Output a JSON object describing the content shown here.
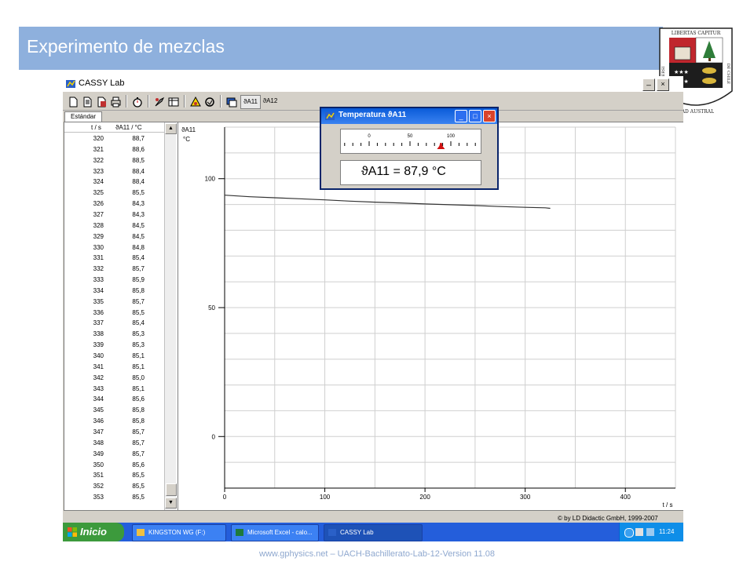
{
  "slide": {
    "title": "Experimento de mezclas",
    "footer": "www.gphysics.net – UACH-Bachillerato-Lab-12-Version 11.08",
    "crest": {
      "top_banner": "LIBERTAS CAPITUR",
      "left_banner": "UNIVERSI",
      "bottom_banner": "DAD AUSTRAL",
      "right_banner": "DE CHILE"
    }
  },
  "app": {
    "title": "CASSY Lab",
    "tab": "Estándar",
    "toolbar_icons": [
      "new-icon",
      "open-icon",
      "save-icon",
      "print-icon",
      "stopwatch-icon",
      "settings-icon",
      "table-icon",
      "measure-icon",
      "clear-icon",
      "window-icon"
    ],
    "sensor_buttons": [
      "ϑA11",
      "ϑA12"
    ],
    "table": {
      "headers": [
        "t / s",
        "ϑA11 / °C"
      ],
      "rows": [
        [
          "320",
          "88,7"
        ],
        [
          "321",
          "88,6"
        ],
        [
          "322",
          "88,5"
        ],
        [
          "323",
          "88,4"
        ],
        [
          "324",
          "88,4"
        ],
        [
          "325",
          "85,5"
        ],
        [
          "326",
          "84,3"
        ],
        [
          "327",
          "84,3"
        ],
        [
          "328",
          "84,5"
        ],
        [
          "329",
          "84,5"
        ],
        [
          "330",
          "84,8"
        ],
        [
          "331",
          "85,4"
        ],
        [
          "332",
          "85,7"
        ],
        [
          "333",
          "85,9"
        ],
        [
          "334",
          "85,8"
        ],
        [
          "335",
          "85,7"
        ],
        [
          "336",
          "85,5"
        ],
        [
          "337",
          "85,4"
        ],
        [
          "338",
          "85,3"
        ],
        [
          "339",
          "85,3"
        ],
        [
          "340",
          "85,1"
        ],
        [
          "341",
          "85,1"
        ],
        [
          "342",
          "85,0"
        ],
        [
          "343",
          "85,1"
        ],
        [
          "344",
          "85,6"
        ],
        [
          "345",
          "85,8"
        ],
        [
          "346",
          "85,8"
        ],
        [
          "347",
          "85,7"
        ],
        [
          "348",
          "85,7"
        ],
        [
          "349",
          "85,7"
        ],
        [
          "350",
          "85,6"
        ],
        [
          "351",
          "85,5"
        ],
        [
          "352",
          "85,5"
        ],
        [
          "353",
          "85,5"
        ]
      ]
    },
    "copyright": "© by LD Didactic GmbH, 1999-2007",
    "taskbar": {
      "start": "Inicio",
      "tasks": [
        "KINGSTON WG (F:)",
        "Microsoft Excel - calo...",
        "CASSY Lab"
      ],
      "clock": "11:24"
    }
  },
  "dialog": {
    "title": "Temperatura ϑA11",
    "scale_ticks": [
      "0",
      "50",
      "100"
    ],
    "scale_pointer_value": 87.9,
    "readout_symbol": "ϑA11",
    "readout_value": "= 87,9 °C"
  },
  "chart_data": {
    "type": "line",
    "y_axis_label": "ϑA11",
    "y_axis_unit": "°C",
    "x_axis_label": "t / s",
    "x_ticks": [
      0,
      100,
      200,
      300,
      400
    ],
    "y_ticks": [
      0,
      50,
      100
    ],
    "xlim": [
      0,
      450
    ],
    "ylim": [
      -20,
      120
    ],
    "grid": true,
    "series": [
      {
        "color": "#333333",
        "x": [
          0,
          25,
          50,
          75,
          100,
          125,
          150,
          175,
          200,
          225,
          250,
          275,
          300,
          320,
          325
        ],
        "y": [
          93.6,
          93.0,
          92.6,
          92.2,
          91.8,
          91.3,
          90.9,
          90.6,
          90.2,
          89.9,
          89.6,
          89.2,
          88.9,
          88.7,
          88.5
        ]
      }
    ],
    "colors": {
      "line": "#333333",
      "grid": "#cfcfcf",
      "axis": "#000000"
    }
  }
}
